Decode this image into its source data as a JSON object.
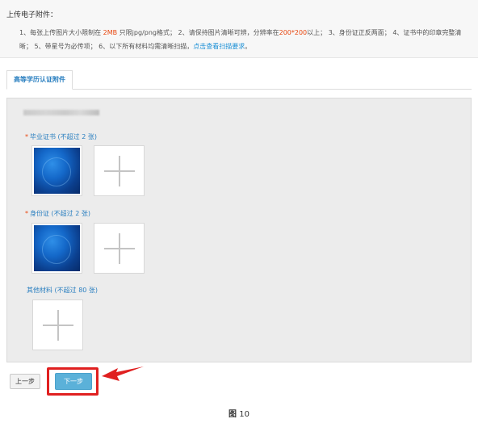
{
  "notice": {
    "title": "上传电子附件：",
    "line_prefix": "1、每张上传图片大小限制在 ",
    "size_limit": "2MB",
    "line_mid1": " 只限jpg/png格式；  2、请保持图片清晰可辨，分辨率在",
    "resolution": "200*200",
    "line_mid2": "以上；  3、身份证正反两面；  4、证书中的印章完整清晰；  5、带星号为必传项；  6、以下所有材料均需清晰扫描，",
    "link": "点击查看扫描要求",
    "line_end": "。"
  },
  "tab": {
    "label": "高等学历认证附件"
  },
  "sections": [
    {
      "required_mark": "*",
      "label": "毕业证书 (不超过 2 张)"
    },
    {
      "required_mark": "*",
      "label": "身份证 (不超过 2 张)"
    },
    {
      "required_mark": "",
      "label": "其他材料 (不超过 80 张)"
    }
  ],
  "buttons": {
    "prev": "上一步",
    "next": "下一步"
  },
  "caption": {
    "prefix": "图",
    "number": "10"
  },
  "colors": {
    "accent": "#2a7fc0",
    "highlight": "#e8470f",
    "next_button": "#5bb1d9",
    "annotation": "#e02020"
  }
}
